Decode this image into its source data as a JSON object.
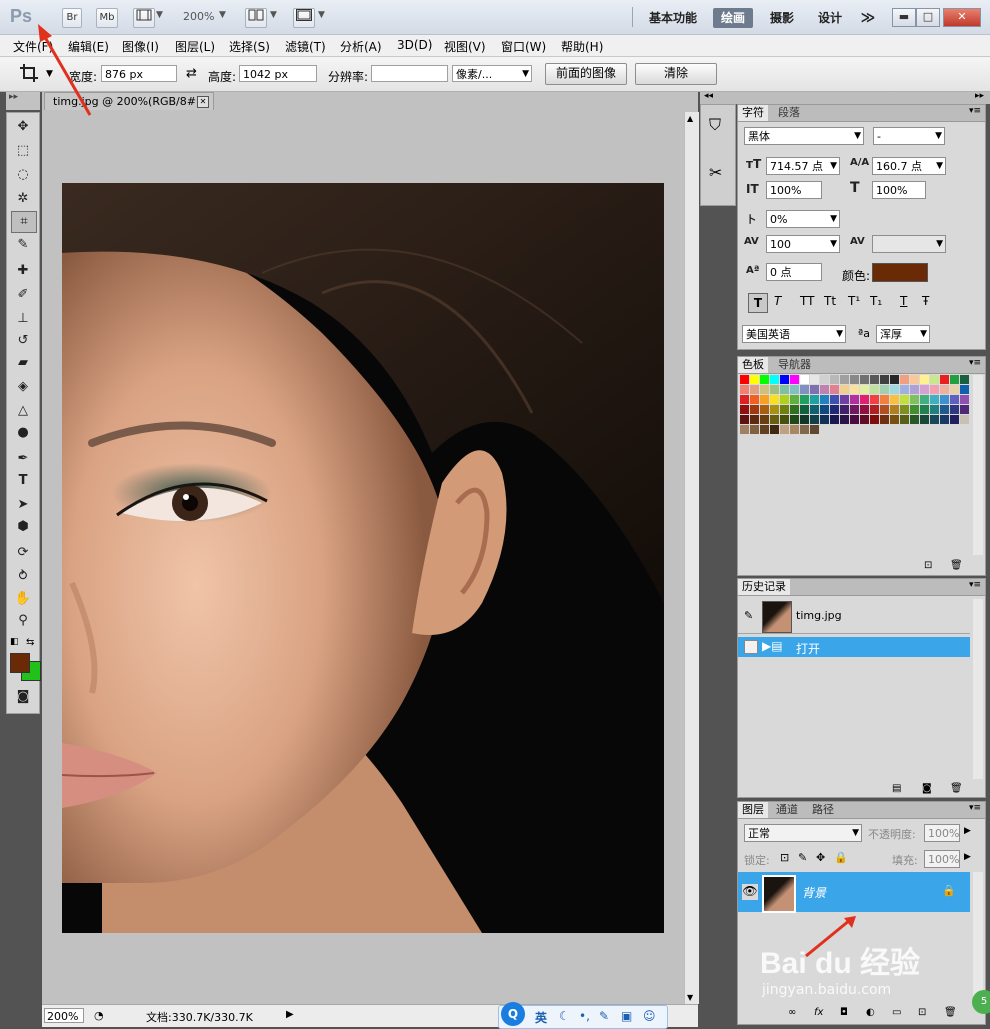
{
  "titlebar": {
    "logo": "Ps",
    "bridge": "Br",
    "minibridge": "Mb",
    "zoom": "200%",
    "workspaces": [
      "基本功能",
      "绘画",
      "摄影",
      "设计"
    ],
    "active_workspace": "绘画",
    "more": "≫"
  },
  "menubar": [
    "文件(F)",
    "编辑(E)",
    "图像(I)",
    "图层(L)",
    "选择(S)",
    "滤镜(T)",
    "分析(A)",
    "3D(D)",
    "视图(V)",
    "窗口(W)",
    "帮助(H)"
  ],
  "options": {
    "width_label": "宽度:",
    "width_value": "876 px",
    "height_label": "高度:",
    "height_value": "1042 px",
    "resolution_label": "分辨率:",
    "resolution_value": "",
    "unit": "像素/...",
    "front_image_button": "前面的图像",
    "clear_button": "清除"
  },
  "document": {
    "tab_title": "timg.jpg @ 200%(RGB/8#)",
    "status_zoom": "200%",
    "status_doc": "文档:330.7K/330.7K"
  },
  "tools": [
    "move-icon",
    "marquee-icon",
    "lasso-icon",
    "quick-select-icon",
    "crop-icon",
    "eyedropper-icon",
    "healing-icon",
    "brush-icon",
    "stamp-icon",
    "history-brush-icon",
    "eraser-icon",
    "bucket-icon",
    "blur-icon",
    "dodge-icon",
    "pen-icon",
    "type-icon",
    "path-select-icon",
    "shape-icon",
    "3d-rotate-icon",
    "3d-orbit-icon",
    "hand-icon",
    "zoom-icon"
  ],
  "colors": {
    "foreground": "#6b2a06",
    "background": "#22c01a",
    "font_color": "#6b2a06",
    "selection": "#3ba5ea"
  },
  "character": {
    "tabs": [
      "字符",
      "段落"
    ],
    "font_family": "黑体",
    "font_style": "-",
    "font_size": "714.57 点",
    "leading": "160.7 点",
    "vertical_scale": "100%",
    "horizontal_scale": "100%",
    "tsume": "0%",
    "tracking": "100",
    "kerning": "",
    "baseline": "0 点",
    "color_label": "颜色:",
    "language": "美国英语",
    "antialias_label": "a",
    "antialias": "浑厚",
    "style_buttons": [
      "T",
      "T",
      "TT",
      "Tt",
      "T¹",
      "T₁",
      "T",
      "Ŧ"
    ]
  },
  "swatches": {
    "tabs": [
      "色板",
      "导航器"
    ],
    "colors": [
      "#ff0000",
      "#ffff00",
      "#00ff00",
      "#00ffff",
      "#0000ff",
      "#ff00ff",
      "#ffffff",
      "#e6e6e6",
      "#d0d0d0",
      "#b8b8b8",
      "#a0a0a0",
      "#888888",
      "#707070",
      "#585858",
      "#404040",
      "#282828",
      "#f0a080",
      "#f8c898",
      "#fff090",
      "#c8e890",
      "#e82020",
      "#20a040",
      "#1a6040",
      "#f08070",
      "#e0a080",
      "#d0c080",
      "#a0c080",
      "#80c0a0",
      "#80c0c0",
      "#8090c0",
      "#8070b0",
      "#c080b0",
      "#e08090",
      "#f0d090",
      "#f8e0a0",
      "#e0f0a0",
      "#c0e0a0",
      "#a0d0b0",
      "#a0d8e0",
      "#a0b0e0",
      "#b0a0d8",
      "#d8a0d0",
      "#f0a0b0",
      "#f0b0a0",
      "#e8d0a8",
      "#1060b0",
      "#e02020",
      "#f06020",
      "#f8a020",
      "#f8e020",
      "#b0d020",
      "#60b040",
      "#20a060",
      "#20a0a0",
      "#2080c0",
      "#4050b0",
      "#7040a0",
      "#b030a0",
      "#e02070",
      "#f04040",
      "#f08040",
      "#f8c040",
      "#c0e040",
      "#80c060",
      "#40b080",
      "#40b0c0",
      "#4090d0",
      "#6060c0",
      "#9050b0",
      "#901010",
      "#a03810",
      "#a86010",
      "#a89010",
      "#708010",
      "#307020",
      "#106040",
      "#106070",
      "#104880",
      "#202878",
      "#402068",
      "#701860",
      "#901040",
      "#b02020",
      "#b05020",
      "#b08020",
      "#809020",
      "#409030",
      "#208050",
      "#208080",
      "#205890",
      "#303880",
      "#502878",
      "#601010",
      "#602810",
      "#684010",
      "#686010",
      "#485010",
      "#204818",
      "#103828",
      "#104048",
      "#103058",
      "#181850",
      "#281448",
      "#480c40",
      "#600c28",
      "#800c0c",
      "#703010",
      "#785010",
      "#586018",
      "#285828",
      "#184838",
      "#184858",
      "#183868",
      "#202060",
      "#c8c0b0",
      "#a08060",
      "#806040",
      "#604020",
      "#402810",
      "#c0a080",
      "#a88860",
      "#806848",
      "#604830"
    ]
  },
  "history": {
    "tab": "历史记录",
    "snapshot": "timg.jpg",
    "step": "打开"
  },
  "layers": {
    "tabs": [
      "图层",
      "通道",
      "路径"
    ],
    "blend_mode": "正常",
    "opacity_label": "不透明度:",
    "opacity": "100%",
    "lock_label": "锁定:",
    "fill_label": "填充:",
    "fill": "100%",
    "layer_name": "背景"
  },
  "taskbar": {
    "ime": "英",
    "watermark_brand": "Bai du 经验",
    "watermark_url": "jingyan.baidu.com"
  }
}
